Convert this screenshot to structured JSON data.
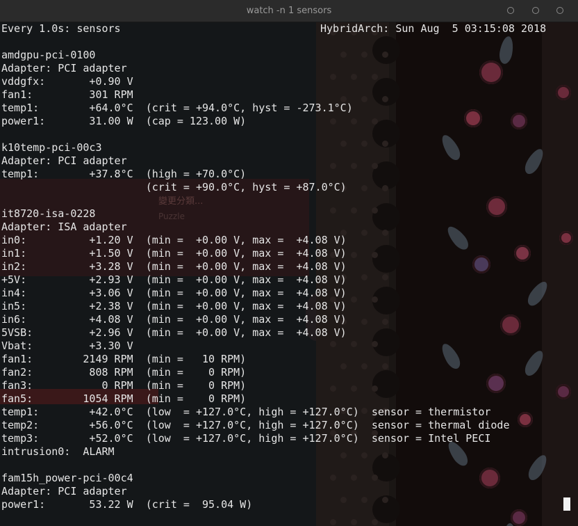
{
  "window": {
    "title": "watch -n 1 sensors"
  },
  "header": {
    "left": "Every 1.0s: sensors",
    "right": "HybridArch: Sun Aug  5 03:15:08 2018"
  },
  "lines": [
    "",
    "amdgpu-pci-0100",
    "Adapter: PCI adapter",
    "vddgfx:       +0.90 V",
    "fan1:         301 RPM",
    "temp1:        +64.0°C  (crit = +94.0°C, hyst = -273.1°C)",
    "power1:       31.00 W  (cap = 123.00 W)",
    "",
    "k10temp-pci-00c3",
    "Adapter: PCI adapter",
    "temp1:        +37.8°C  (high = +70.0°C)",
    "                       (crit = +90.0°C, hyst = +87.0°C)",
    "",
    "it8720-isa-0228",
    "Adapter: ISA adapter",
    "in0:          +1.20 V  (min =  +0.00 V, max =  +4.08 V)",
    "in1:          +1.50 V  (min =  +0.00 V, max =  +4.08 V)",
    "in2:          +3.28 V  (min =  +0.00 V, max =  +4.08 V)",
    "+5V:          +2.93 V  (min =  +0.00 V, max =  +4.08 V)",
    "in4:          +3.06 V  (min =  +0.00 V, max =  +4.08 V)",
    "in5:          +2.38 V  (min =  +0.00 V, max =  +4.08 V)",
    "in6:          +4.08 V  (min =  +0.00 V, max =  +4.08 V)",
    "5VSB:         +2.96 V  (min =  +0.00 V, max =  +4.08 V)",
    "Vbat:         +3.30 V",
    "fan1:        2149 RPM  (min =   10 RPM)",
    "fan2:         808 RPM  (min =    0 RPM)",
    "fan3:           0 RPM  (min =    0 RPM)",
    "fan5:        1054 RPM  (min =    0 RPM)",
    "temp1:        +42.0°C  (low  = +127.0°C, high = +127.0°C)  sensor = thermistor",
    "temp2:        +56.0°C  (low  = +127.0°C, high = +127.0°C)  sensor = thermal diode",
    "temp3:        +52.0°C  (low  = +127.0°C, high = +127.0°C)  sensor = Intel PECI",
    "intrusion0:  ALARM",
    "",
    "fam15h_power-pci-00c4",
    "Adapter: PCI adapter",
    "power1:       53.22 W  (crit =  95.04 W)"
  ],
  "background_window": {
    "text1": "變更分類...",
    "text2": "Puzzle"
  },
  "colors": {
    "terminal_bg": "#141719",
    "terminal_fg": "#e6e6e6",
    "titlebar_bg": "#2b2b2b"
  }
}
